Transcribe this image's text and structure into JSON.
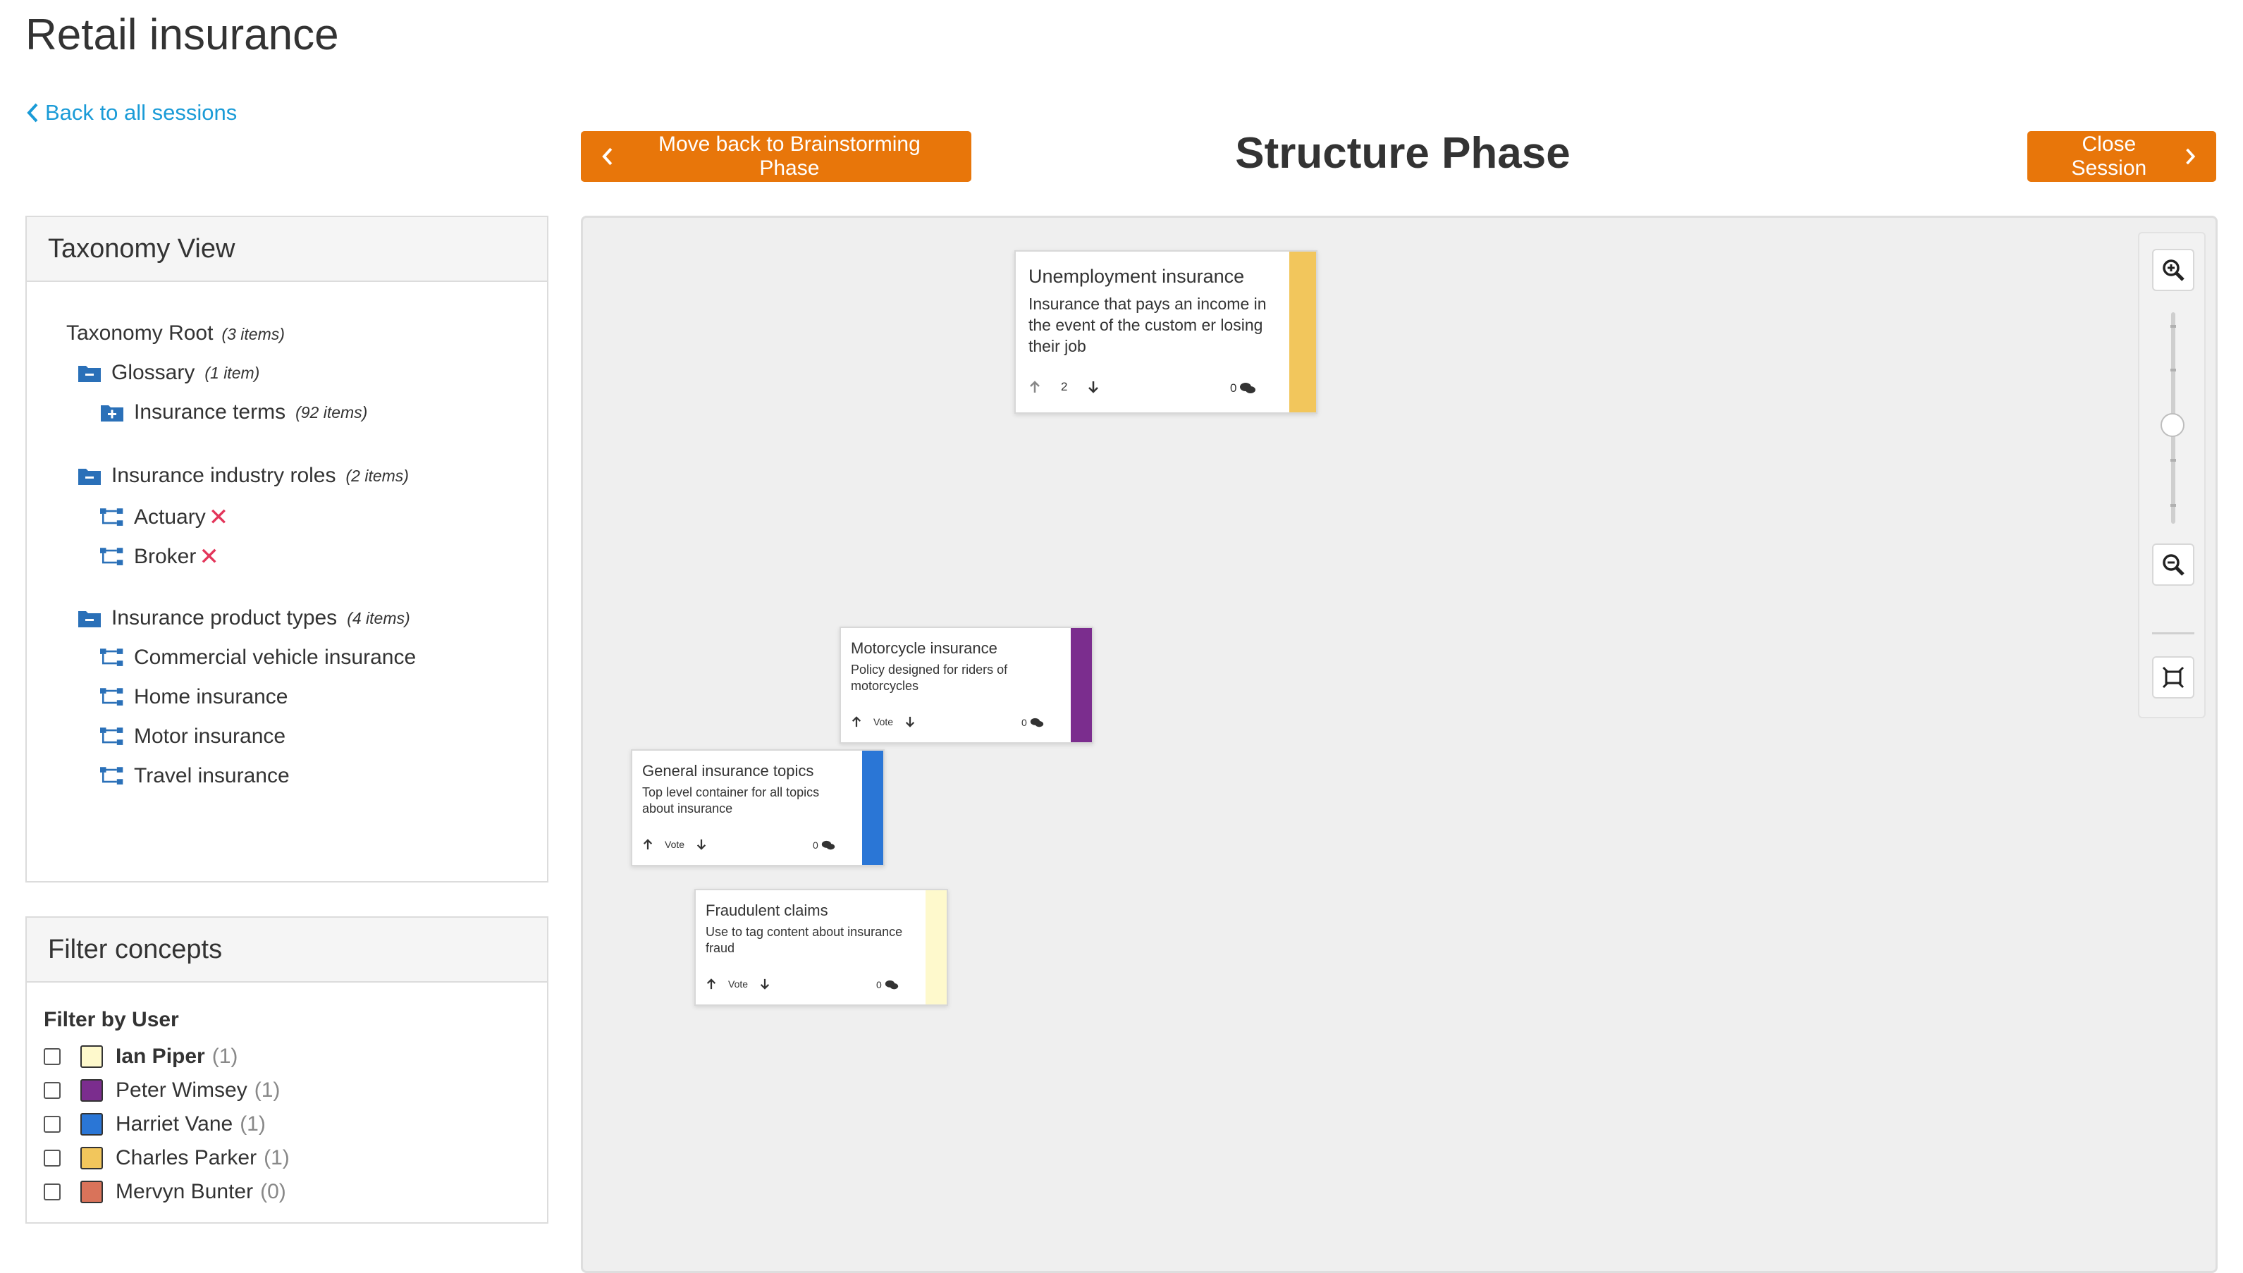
{
  "page": {
    "title": "Retail insurance",
    "back_link": "Back to all sessions",
    "phase_title": "Structure Phase",
    "back_phase_button": "Move back to Brainstorming Phase",
    "close_button": "Close Session"
  },
  "colors": {
    "accent_orange": "#e8760a",
    "link_blue": "#1a9bd7",
    "folder_blue": "#2a70b8",
    "remove_red": "#e3355a"
  },
  "taxonomy": {
    "header": "Taxonomy View",
    "root": {
      "label": "Taxonomy Root",
      "count": "(3 items)"
    },
    "groups": [
      {
        "label": "Glossary",
        "count": "(1 item)",
        "icon": "folder-minus-icon",
        "children": [
          {
            "label": "Insurance terms",
            "count": "(92 items)",
            "icon": "folder-plus-icon"
          }
        ]
      },
      {
        "label": "Insurance industry roles",
        "count": "(2 items)",
        "icon": "folder-minus-icon",
        "children": [
          {
            "label": "Actuary",
            "icon": "hierarchy-icon",
            "removable": true
          },
          {
            "label": "Broker",
            "icon": "hierarchy-icon",
            "removable": true
          }
        ]
      },
      {
        "label": "Insurance product types",
        "count": "(4 items)",
        "icon": "folder-minus-icon",
        "children": [
          {
            "label": "Commercial vehicle insurance",
            "icon": "hierarchy-icon"
          },
          {
            "label": "Home insurance",
            "icon": "hierarchy-icon"
          },
          {
            "label": "Motor insurance",
            "icon": "hierarchy-icon"
          },
          {
            "label": "Travel insurance",
            "icon": "hierarchy-icon"
          }
        ]
      }
    ],
    "remove_glyph": "✕"
  },
  "filter": {
    "header": "Filter concepts",
    "subtitle": "Filter by User",
    "users": [
      {
        "name": "Ian Piper",
        "count": "(1)",
        "color": "#fef9cc",
        "bold": true
      },
      {
        "name": "Peter Wimsey",
        "count": "(1)",
        "color": "#7b2d8e"
      },
      {
        "name": "Harriet Vane",
        "count": "(1)",
        "color": "#2a76d6"
      },
      {
        "name": "Charles Parker",
        "count": "(1)",
        "color": "#f2c65c"
      },
      {
        "name": "Mervyn Bunter",
        "count": "(0)",
        "color": "#d9735a"
      }
    ]
  },
  "cards": [
    {
      "id": "unemployment",
      "title": "Unemployment insurance",
      "desc": "Insurance that pays an income in the event of the custom er losing their job",
      "vote": "2",
      "comments": "0",
      "color": "#f2c65c"
    },
    {
      "id": "motorcycle",
      "title": "Motorcycle insurance",
      "desc": "Policy designed for riders of motorcycles",
      "vote": "Vote",
      "comments": "0",
      "color": "#7b2d8e"
    },
    {
      "id": "general",
      "title": "General insurance topics",
      "desc": "Top level container for all topics about insurance",
      "vote": "Vote",
      "comments": "0",
      "color": "#2a76d6"
    },
    {
      "id": "fraud",
      "title": "Fraudulent claims",
      "desc": "Use to tag content about insurance fraud",
      "vote": "Vote",
      "comments": "0",
      "color": "#fef9cc"
    }
  ],
  "zoom": {
    "level": 0.5
  }
}
